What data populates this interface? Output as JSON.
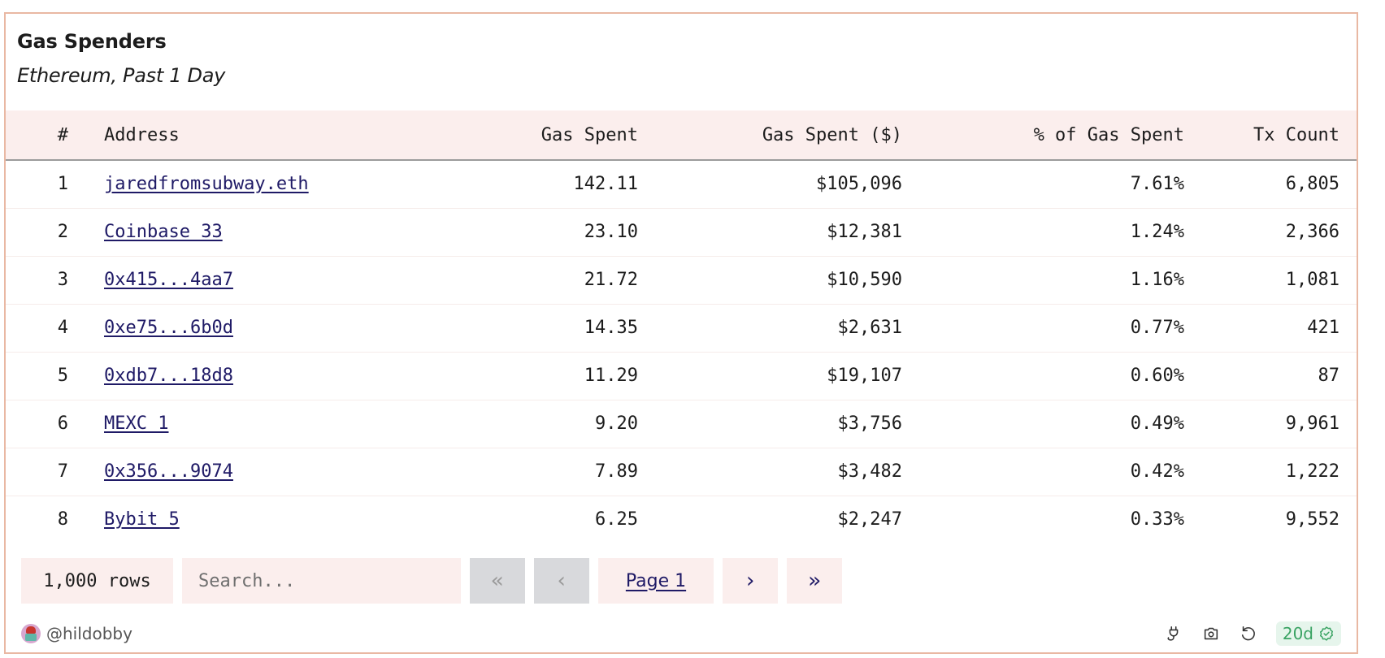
{
  "title": "Gas Spenders",
  "subtitle": "Ethereum, Past 1 Day",
  "table": {
    "columns": [
      "#",
      "Address",
      "Gas Spent",
      "Gas Spent ($)",
      "% of Gas Spent",
      "Tx Count"
    ],
    "rows": [
      {
        "rank": "1",
        "address": "jaredfromsubway.eth",
        "gas_spent": "142.11",
        "gas_spent_usd": "$105,096",
        "pct_gas_spent": "7.61%",
        "tx_count": "6,805"
      },
      {
        "rank": "2",
        "address": "Coinbase 33",
        "gas_spent": "23.10",
        "gas_spent_usd": "$12,381",
        "pct_gas_spent": "1.24%",
        "tx_count": "2,366"
      },
      {
        "rank": "3",
        "address": "0x415...4aa7",
        "gas_spent": "21.72",
        "gas_spent_usd": "$10,590",
        "pct_gas_spent": "1.16%",
        "tx_count": "1,081"
      },
      {
        "rank": "4",
        "address": "0xe75...6b0d",
        "gas_spent": "14.35",
        "gas_spent_usd": "$2,631",
        "pct_gas_spent": "0.77%",
        "tx_count": "421"
      },
      {
        "rank": "5",
        "address": "0xdb7...18d8",
        "gas_spent": "11.29",
        "gas_spent_usd": "$19,107",
        "pct_gas_spent": "0.60%",
        "tx_count": "87"
      },
      {
        "rank": "6",
        "address": "MEXC 1",
        "gas_spent": "9.20",
        "gas_spent_usd": "$3,756",
        "pct_gas_spent": "0.49%",
        "tx_count": "9,961"
      },
      {
        "rank": "7",
        "address": "0x356...9074",
        "gas_spent": "7.89",
        "gas_spent_usd": "$3,482",
        "pct_gas_spent": "0.42%",
        "tx_count": "1,222"
      },
      {
        "rank": "8",
        "address": "Bybit 5",
        "gas_spent": "6.25",
        "gas_spent_usd": "$2,247",
        "pct_gas_spent": "0.33%",
        "tx_count": "9,552"
      }
    ]
  },
  "pager": {
    "row_count": "1,000 rows",
    "search_placeholder": "Search...",
    "search_value": "",
    "first_icon": "«",
    "prev_icon": "‹",
    "page_label": "Page 1",
    "next_icon": "›",
    "last_icon": "»"
  },
  "footer": {
    "author": "@hildobby",
    "icons": [
      "plug-icon",
      "camera-icon",
      "refresh-icon"
    ],
    "age_badge": "20d",
    "age_badge_icon": "verified-check-icon"
  },
  "colors": {
    "card_border": "#e9b8a3",
    "header_bg": "#fbeeed",
    "link": "#1f1a66",
    "disabled_button": "#d8d9dc",
    "badge_bg": "#e6f5ec",
    "badge_text": "#3aa363"
  }
}
